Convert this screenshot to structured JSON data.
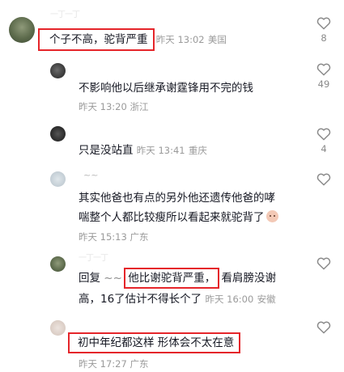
{
  "comments": [
    {
      "name": "一丁一丁",
      "text": "个子不高，驼背严重",
      "time": "昨天 13:02",
      "location": "美国",
      "likes": "8"
    },
    {
      "text": "不影响他以后继承谢霆锋用不完的钱",
      "time": "昨天 13:20",
      "location": "浙江",
      "likes": "49"
    },
    {
      "text": "只是没站直",
      "time": "昨天 13:41",
      "location": "重庆",
      "likes": "4"
    },
    {
      "name": "~~",
      "line1": "其实他爸也有点的另外他还遗传他爸的哮",
      "line2": "喘整个人都比较瘦所以看起来就驼背了",
      "time": "昨天 15:13",
      "location": "广东",
      "likes": ""
    },
    {
      "name": "一丁一丁",
      "reply_prefix": "回复",
      "reply_to": "~~",
      "highlight": "他比谢驼背严重，",
      "rest": "看肩膀没谢",
      "line2": "高，16了估计不得长个了",
      "time": "昨天 16:00",
      "location": "安徽",
      "likes": ""
    },
    {
      "text": "初中年纪都这样 形体会不太在意",
      "time": "昨天 17:27",
      "location": "广东",
      "likes": ""
    }
  ],
  "colors": {
    "highlight_box": "#e5252a",
    "meta_text": "#9a9a9a"
  },
  "icons": {
    "like": "heart-outline-icon"
  }
}
